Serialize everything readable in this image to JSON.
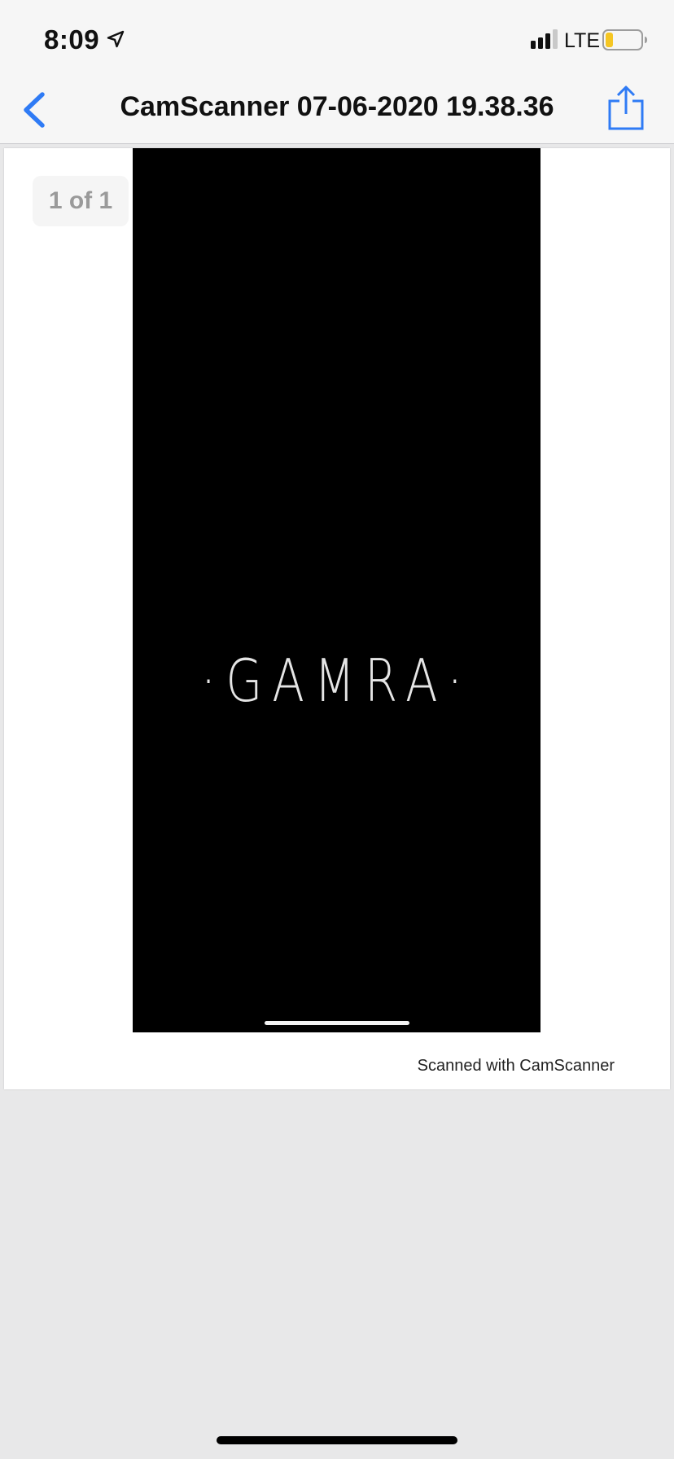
{
  "status_bar": {
    "time": "8:09",
    "location_icon": "location-arrow-icon",
    "signal_icon": "cellular-signal-icon",
    "network": "LTE",
    "battery_icon": "battery-low-icon",
    "battery_color": "#f5c623"
  },
  "nav": {
    "back_icon": "chevron-left-icon",
    "title": "CamScanner 07-06-2020 19.38.36",
    "share_icon": "share-icon",
    "accent": "#2f7bf5"
  },
  "document": {
    "page_counter": "1 of 1",
    "scan_logo_text": "·GAMRA·",
    "watermark": "Scanned with CamScanner"
  }
}
